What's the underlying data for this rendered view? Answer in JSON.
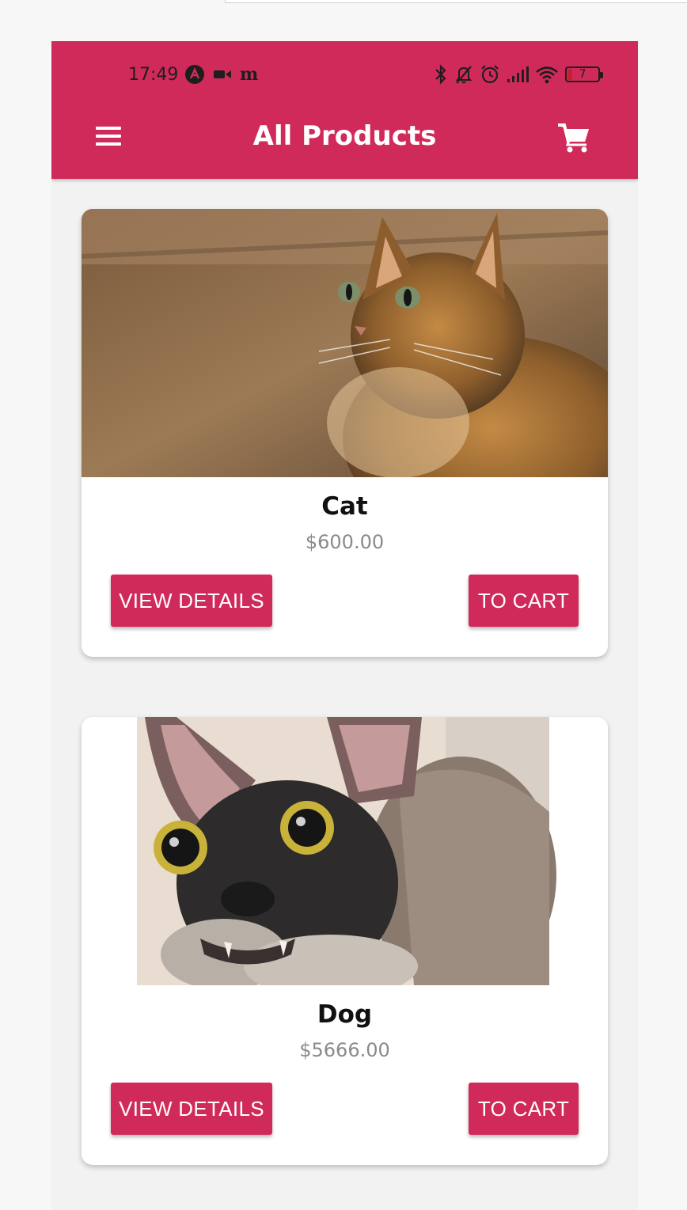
{
  "status_bar": {
    "time": "17:49",
    "carrier_glyph": "m",
    "battery_level": "7",
    "icons": [
      "vpn-icon",
      "video-icon",
      "bluetooth-icon",
      "bell-off-icon",
      "alarm-icon",
      "signal-icon",
      "wifi-icon",
      "battery-icon"
    ]
  },
  "header": {
    "title": "All Products",
    "menu_icon": "hamburger-menu-icon",
    "cart_icon": "shopping-cart-icon",
    "background_color": "#d02a5a"
  },
  "products": [
    {
      "name": "Cat",
      "price": "$600.00",
      "view_label": "VIEW DETAILS",
      "cart_label": "TO CART"
    },
    {
      "name": "Dog",
      "price": "$5666.00",
      "view_label": "VIEW DETAILS",
      "cart_label": "TO CART"
    }
  ],
  "colors": {
    "accent": "#d02a5a",
    "price_text": "#8a8a8a",
    "page_background": "#f2f2f2"
  }
}
